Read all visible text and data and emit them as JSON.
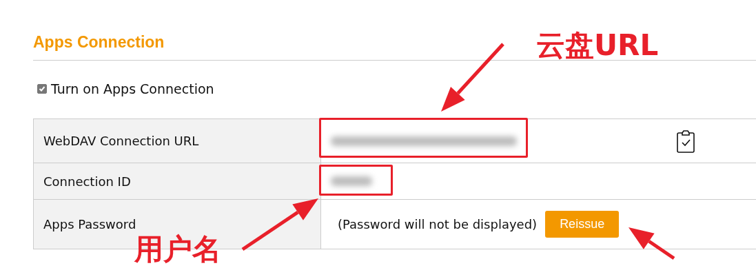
{
  "section": {
    "title": "Apps Connection"
  },
  "toggle": {
    "label": "Turn on Apps Connection",
    "checked": true
  },
  "settings": [
    {
      "label": "WebDAV Connection URL",
      "kind": "redacted",
      "copy": true
    },
    {
      "label": "Connection ID",
      "kind": "redacted",
      "copy": false
    },
    {
      "label": "Apps Password",
      "kind": "password",
      "note": "(Password will not be displayed)",
      "button": "Reissue"
    }
  ],
  "annotations": [
    {
      "label": "云盘URL"
    },
    {
      "label": "用户名"
    }
  ]
}
